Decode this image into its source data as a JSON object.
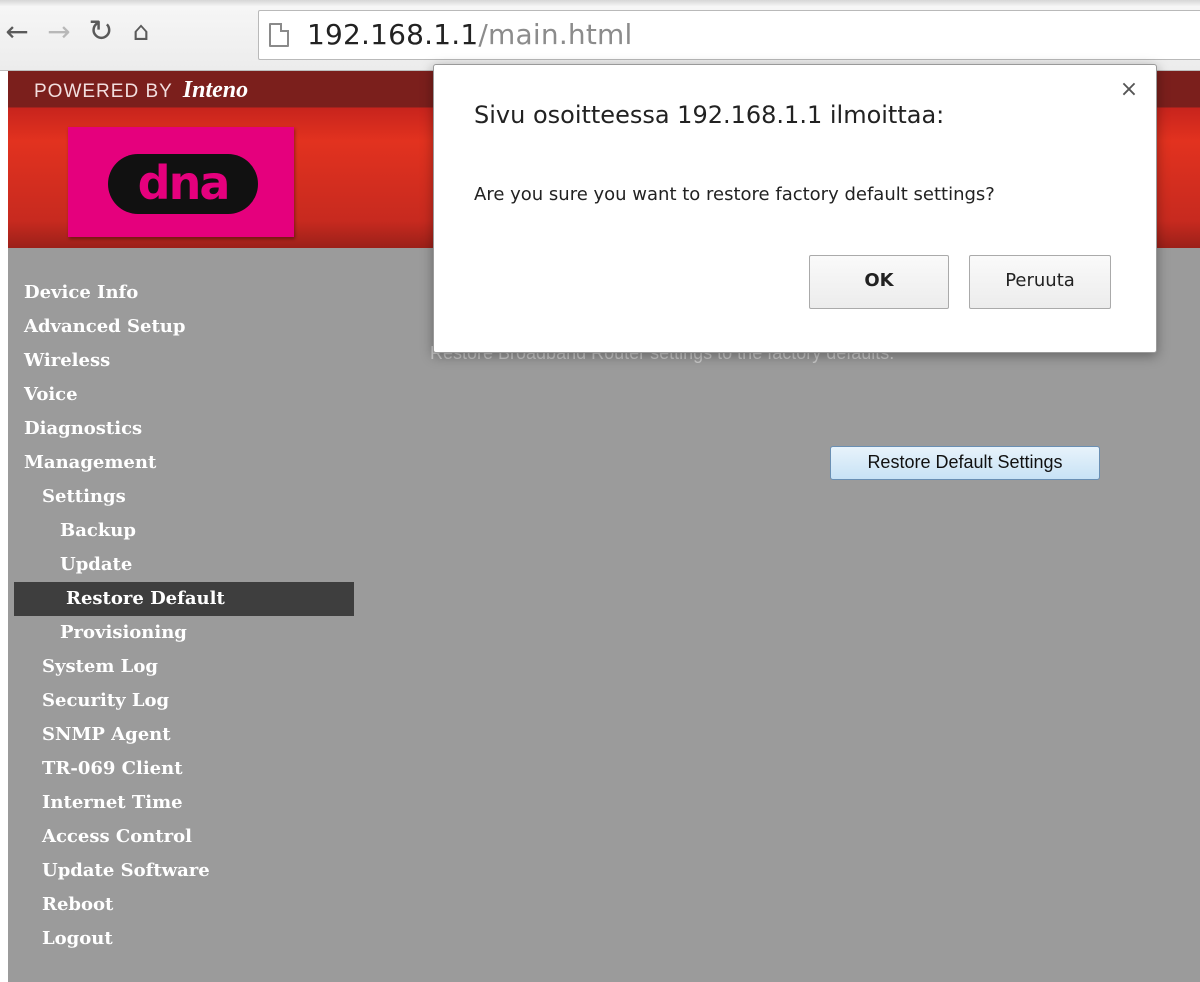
{
  "browser": {
    "url_host": "192.168.1.1",
    "url_path": "/main.html",
    "icons": [
      "back-arrow-icon",
      "forward-arrow-icon",
      "reload-icon",
      "home-icon",
      "page-icon"
    ]
  },
  "header": {
    "powered_by": "POWERED BY",
    "brand": "Inteno",
    "logo_text": "dna",
    "colors": {
      "header_red": "#d12a1f",
      "logo_pink": "#e5007d"
    }
  },
  "sidebar": {
    "items": [
      {
        "label": "Device Info",
        "level": 0
      },
      {
        "label": "Advanced Setup",
        "level": 0
      },
      {
        "label": "Wireless",
        "level": 0
      },
      {
        "label": "Voice",
        "level": 0
      },
      {
        "label": "Diagnostics",
        "level": 0
      },
      {
        "label": "Management",
        "level": 0
      },
      {
        "label": "Settings",
        "level": 1
      },
      {
        "label": "Backup",
        "level": 2
      },
      {
        "label": "Update",
        "level": 2
      },
      {
        "label": "Restore Default",
        "level": 2,
        "active": true
      },
      {
        "label": "Provisioning",
        "level": 2
      },
      {
        "label": "System Log",
        "level": 1
      },
      {
        "label": "Security Log",
        "level": 1
      },
      {
        "label": "SNMP Agent",
        "level": 1
      },
      {
        "label": "TR-069 Client",
        "level": 1
      },
      {
        "label": "Internet Time",
        "level": 1
      },
      {
        "label": "Access Control",
        "level": 1
      },
      {
        "label": "Update Software",
        "level": 1
      },
      {
        "label": "Reboot",
        "level": 1
      },
      {
        "label": "Logout",
        "level": 1
      }
    ]
  },
  "main": {
    "description": "Restore Broadband Router settings to the factory defaults.",
    "restore_button": "Restore Default Settings"
  },
  "dialog": {
    "title": "Sivu osoitteessa 192.168.1.1 ilmoittaa:",
    "message": "Are you sure you want to restore factory default settings?",
    "ok_label": "OK",
    "cancel_label": "Peruuta",
    "close_glyph": "×"
  }
}
